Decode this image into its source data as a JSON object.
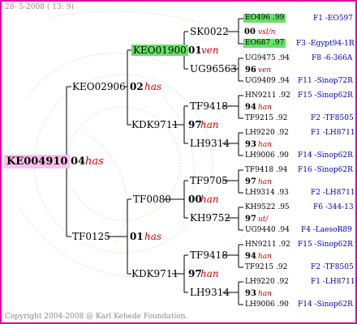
{
  "header": {
    "date": "28- 5-2008 ( 13: 9)"
  },
  "footer": {
    "copyright": "Copyright 2004-2008 @ Karl Kehede Foundation."
  },
  "root": {
    "id": "KE004910",
    "number": "04",
    "tag": "has"
  },
  "gen1": [
    {
      "id": "KEO02906",
      "number": "02",
      "tag": "has"
    },
    {
      "id": "TF0125",
      "number": "01",
      "tag": "has"
    }
  ],
  "gen2": [
    {
      "id": "KEO01900",
      "number": "01",
      "tag": "ven"
    },
    {
      "id": "KDK9711",
      "number": "97",
      "tag": "han"
    },
    {
      "id": "TF0080",
      "number": "00",
      "tag": "han"
    },
    {
      "id": "KDK9711",
      "number": "97",
      "tag": "han"
    }
  ],
  "gen3": [
    {
      "father": "SK0022",
      "mother": "UG96563"
    },
    {
      "father": "TF9418",
      "mother": "LH9314"
    },
    {
      "father": "TF9705",
      "mother": "KH9752"
    },
    {
      "father": "TF9418",
      "mother": "LH9314"
    }
  ],
  "gen4": [
    {
      "top": "EO496 .99",
      "num": "00",
      "tag": "vsl/n",
      "bottom": "EO687 .97",
      "top_right": "F1 -EO597",
      "bottom_right": "F3 -Egypt94-1R"
    },
    {
      "top": "UG9475 .94",
      "num": "96",
      "tag": "ven",
      "bottom": "UG9409 .94",
      "top_right": "F8 -6-366A",
      "bottom_right": "F11 -Sinop72R"
    },
    {
      "top": "HN9211 .92",
      "num": "94",
      "tag": "han",
      "bottom": "TF9215 .92",
      "top_right": "F15 -Sinop62R",
      "bottom_right": "F2 -TF8505"
    },
    {
      "top": "LH9220 .92",
      "num": "93",
      "tag": "han",
      "bottom": "LH9006 .90",
      "top_right": "F1 -LH8711",
      "bottom_right": "F14 -Sinop62R"
    },
    {
      "top": "TF9418 .94",
      "num": "97",
      "tag": "han",
      "bottom": "LH9314 .93",
      "top_right": "F16 -Sinop62R",
      "bottom_right": "F2 -LH8711"
    },
    {
      "top": "KH9522 .95",
      "num": "97",
      "tag": "ut/",
      "bottom": "UG9440 .94",
      "top_right": "F6 -344-13",
      "bottom_right": "F4 -LaesoR89"
    },
    {
      "top": "HN9211 .92",
      "num": "94",
      "tag": "han",
      "bottom": "TF9215 .92",
      "top_right": "F15 -Sinop62R",
      "bottom_right": "F2 -TF8505"
    },
    {
      "top": "LH9220 .92",
      "num": "93",
      "tag": "han",
      "bottom": "LH9006 .90",
      "top_right": "F1 -LH8711",
      "bottom_right": "F14 -Sinop62R"
    }
  ],
  "colors": {
    "border": "#e000a0",
    "root_bg": "#ffc0f0",
    "highlight_bg": "#66e066",
    "tag": "#cc0000",
    "right_label": "#0000aa"
  }
}
